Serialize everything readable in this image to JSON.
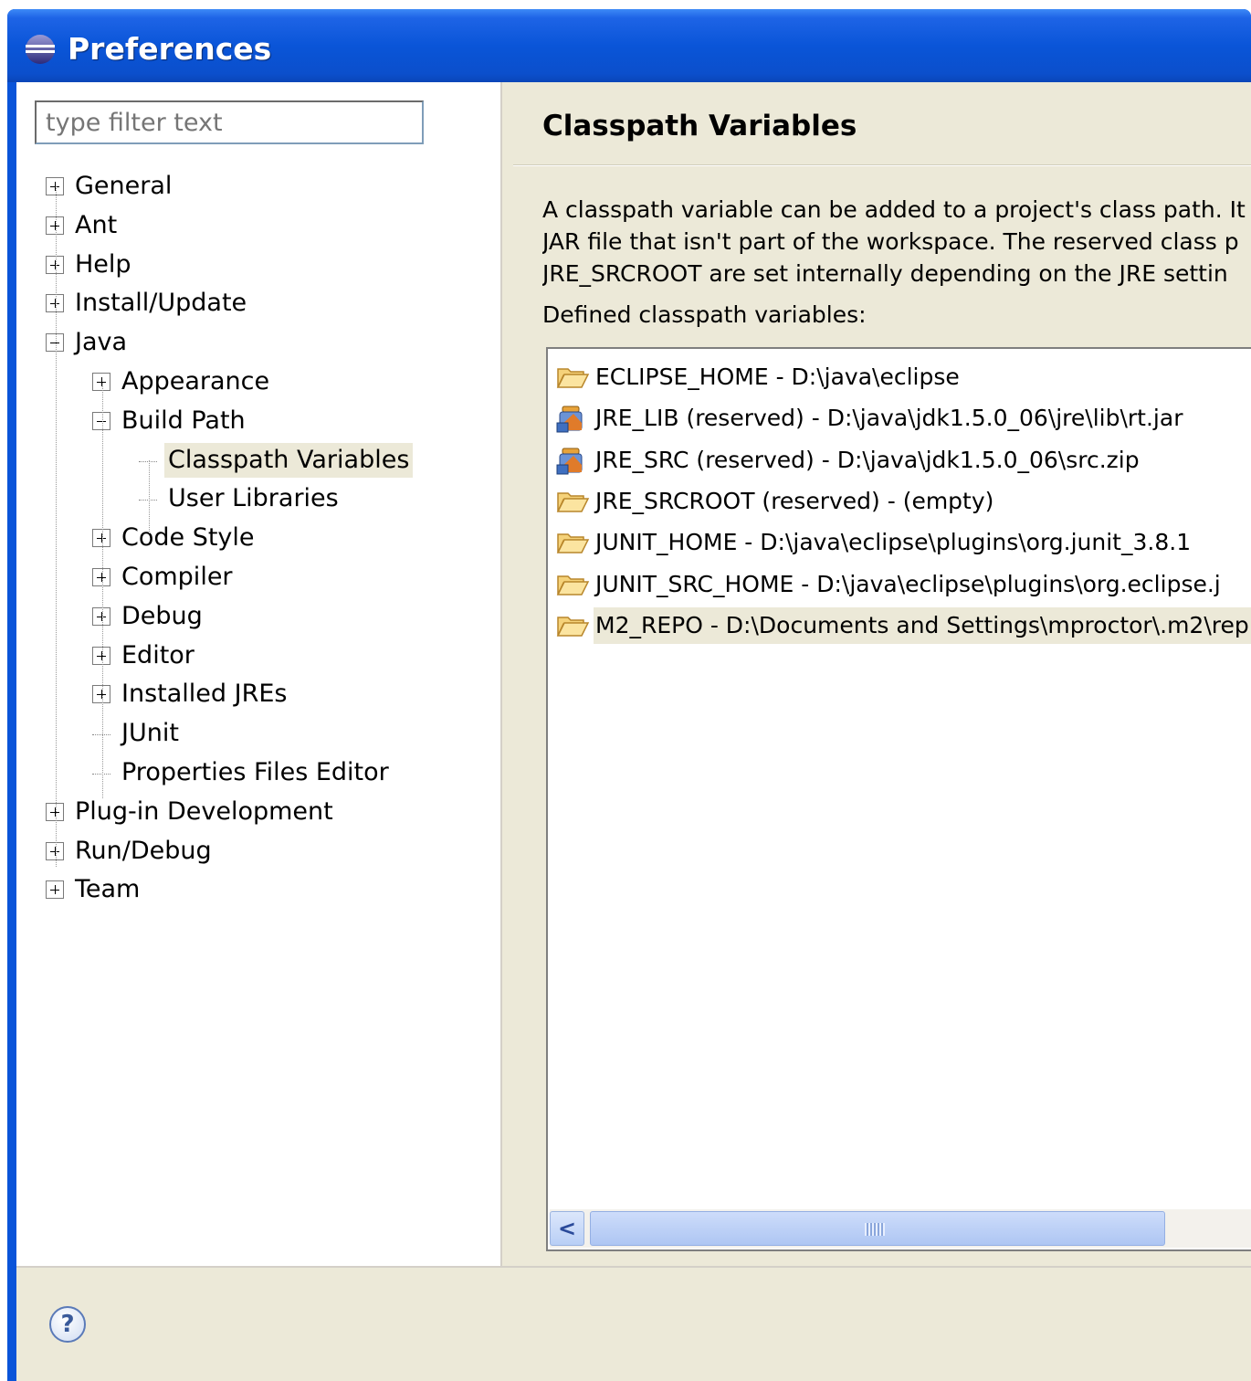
{
  "window": {
    "title": "Preferences"
  },
  "filter": {
    "placeholder": "type filter text"
  },
  "tree": {
    "items": [
      {
        "label": "General",
        "expander": "plus"
      },
      {
        "label": "Ant",
        "expander": "plus"
      },
      {
        "label": "Help",
        "expander": "plus"
      },
      {
        "label": "Install/Update",
        "expander": "plus"
      },
      {
        "label": "Java",
        "expander": "minus"
      },
      {
        "label": "Appearance",
        "expander": "plus"
      },
      {
        "label": "Build Path",
        "expander": "minus"
      },
      {
        "label": "Classpath Variables",
        "expander": "none",
        "selected": true
      },
      {
        "label": "User Libraries",
        "expander": "none"
      },
      {
        "label": "Code Style",
        "expander": "plus"
      },
      {
        "label": "Compiler",
        "expander": "plus"
      },
      {
        "label": "Debug",
        "expander": "plus"
      },
      {
        "label": "Editor",
        "expander": "plus"
      },
      {
        "label": "Installed JREs",
        "expander": "plus"
      },
      {
        "label": "JUnit",
        "expander": "none"
      },
      {
        "label": "Properties Files Editor",
        "expander": "none"
      },
      {
        "label": "Plug-in Development",
        "expander": "plus"
      },
      {
        "label": "Run/Debug",
        "expander": "plus"
      },
      {
        "label": "Team",
        "expander": "plus"
      }
    ]
  },
  "page": {
    "title": "Classpath Variables",
    "description": [
      "A classpath variable can be added to a project's class path. It",
      "JAR file that isn't part of the workspace. The reserved class p",
      "JRE_SRCROOT are set internally depending on the JRE settin"
    ],
    "defined_label": "Defined classpath variables:"
  },
  "variables": [
    {
      "text": "ECLIPSE_HOME - D:\\java\\eclipse",
      "icon": "folder-icon"
    },
    {
      "text": "JRE_LIB (reserved) - D:\\java\\jdk1.5.0_06\\jre\\lib\\rt.jar",
      "icon": "jar-library-icon"
    },
    {
      "text": "JRE_SRC (reserved) - D:\\java\\jdk1.5.0_06\\src.zip",
      "icon": "jar-library-icon"
    },
    {
      "text": "JRE_SRCROOT (reserved) - (empty)",
      "icon": "folder-icon"
    },
    {
      "text": "JUNIT_HOME - D:\\java\\eclipse\\plugins\\org.junit_3.8.1",
      "icon": "folder-icon"
    },
    {
      "text": "JUNIT_SRC_HOME - D:\\java\\eclipse\\plugins\\org.eclipse.j",
      "icon": "folder-icon"
    },
    {
      "text": "M2_REPO - D:\\Documents and Settings\\mproctor\\.m2\\rep",
      "icon": "folder-icon"
    }
  ],
  "scrollbar": {
    "left_arrow": "<"
  },
  "help": {
    "label": "?"
  },
  "colors": {
    "titlebar": "#0a55d8",
    "dialog_bg": "#ece9d8",
    "selection": "#ece9d8"
  }
}
